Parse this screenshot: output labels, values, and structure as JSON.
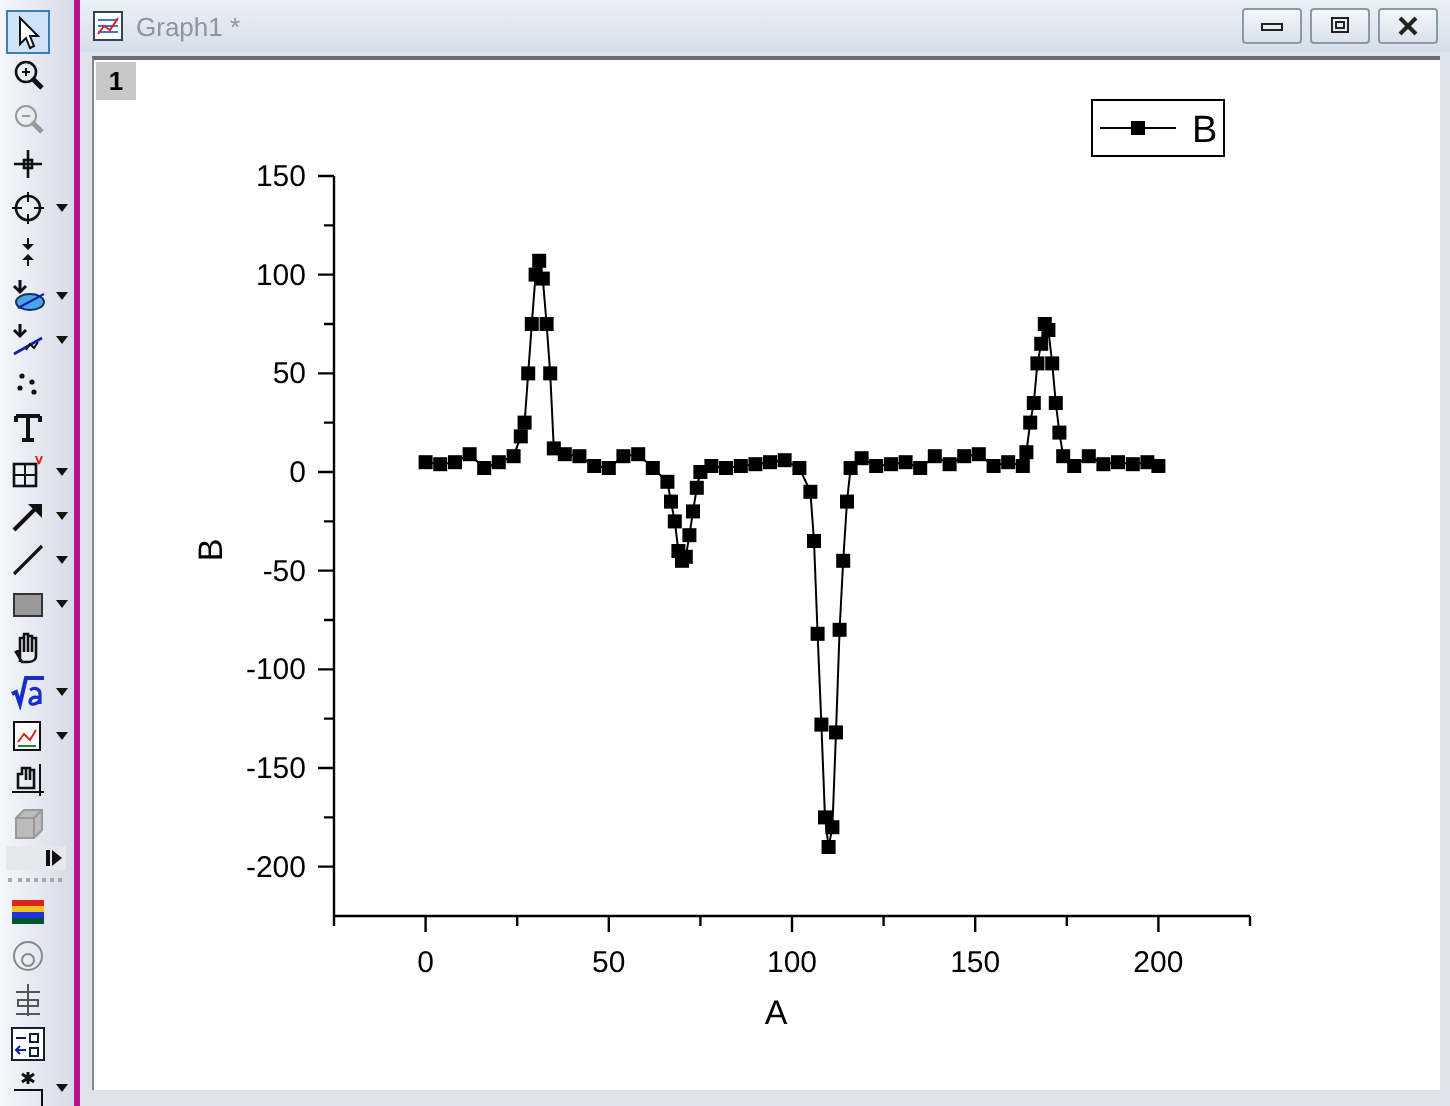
{
  "toolbar": {
    "tools": [
      {
        "kind": "pointer",
        "selected": true,
        "menu": false
      },
      {
        "kind": "zoom-in",
        "selected": false,
        "menu": false
      },
      {
        "kind": "zoom-out",
        "selected": false,
        "menu": false
      },
      {
        "kind": "crosshair",
        "selected": false,
        "menu": false
      },
      {
        "kind": "target",
        "selected": false,
        "menu": true
      },
      {
        "kind": "reader",
        "selected": false,
        "menu": false
      },
      {
        "kind": "region",
        "selected": false,
        "menu": true
      },
      {
        "kind": "mask",
        "selected": false,
        "menu": true
      },
      {
        "kind": "dots",
        "selected": false,
        "menu": false
      },
      {
        "kind": "text",
        "selected": false,
        "menu": false
      },
      {
        "kind": "grid",
        "selected": false,
        "menu": true
      },
      {
        "kind": "arrow",
        "selected": false,
        "menu": true
      },
      {
        "kind": "line",
        "selected": false,
        "menu": true
      },
      {
        "kind": "rectangle",
        "selected": false,
        "menu": true
      },
      {
        "kind": "hand",
        "selected": false,
        "menu": false
      },
      {
        "kind": "sqrt",
        "selected": false,
        "menu": true
      },
      {
        "kind": "graph",
        "selected": false,
        "menu": true
      },
      {
        "kind": "hand-grid",
        "selected": false,
        "menu": false
      },
      {
        "kind": "cube",
        "selected": false,
        "menu": false
      }
    ],
    "lower_tools": [
      {
        "kind": "colorbars",
        "selected": false,
        "menu": false
      },
      {
        "kind": "circle",
        "selected": false,
        "menu": false
      },
      {
        "kind": "component",
        "selected": false,
        "menu": false
      },
      {
        "kind": "bc",
        "selected": false,
        "menu": false
      },
      {
        "kind": "asterisk",
        "selected": false,
        "menu": true
      }
    ]
  },
  "window": {
    "title": "Graph1 *",
    "layer": "1",
    "chart_data": {
      "type": "line",
      "xlabel": "A",
      "ylabel": "B",
      "xlim": [
        -25,
        225
      ],
      "ylim": [
        -225,
        150
      ],
      "xticks": [
        0,
        50,
        100,
        150,
        200
      ],
      "yticks": [
        -200,
        -150,
        -100,
        -50,
        0,
        50,
        100,
        150
      ],
      "x": [
        0,
        4,
        8,
        12,
        16,
        20,
        24,
        26,
        27,
        28,
        29,
        30,
        31,
        32,
        33,
        34,
        35,
        38,
        42,
        46,
        50,
        54,
        58,
        62,
        66,
        67,
        68,
        69,
        70,
        71,
        72,
        73,
        74,
        75,
        78,
        82,
        86,
        90,
        94,
        98,
        102,
        105,
        106,
        107,
        108,
        109,
        110,
        111,
        112,
        113,
        114,
        115,
        116,
        119,
        123,
        127,
        131,
        135,
        139,
        143,
        147,
        151,
        155,
        159,
        163,
        164,
        165,
        166,
        167,
        168,
        169,
        170,
        171,
        172,
        173,
        174,
        177,
        181,
        185,
        189,
        193,
        197,
        200
      ],
      "series": [
        {
          "name": "B",
          "color": "#000000",
          "marker": "square",
          "values": [
            5,
            4,
            5,
            9,
            2,
            5,
            8,
            18,
            25,
            50,
            75,
            100,
            107,
            98,
            75,
            50,
            12,
            9,
            8,
            3,
            2,
            8,
            9,
            2,
            -5,
            -15,
            -25,
            -40,
            -45,
            -43,
            -32,
            -20,
            -8,
            0,
            3,
            2,
            3,
            4,
            5,
            6,
            2,
            -10,
            -35,
            -82,
            -128,
            -175,
            -190,
            -180,
            -132,
            -80,
            -45,
            -15,
            2,
            7,
            3,
            4,
            5,
            2,
            8,
            4,
            8,
            9,
            3,
            5,
            3,
            10,
            25,
            35,
            55,
            65,
            75,
            72,
            55,
            35,
            20,
            8,
            3,
            8,
            4,
            5,
            4,
            5,
            3
          ]
        }
      ]
    }
  }
}
